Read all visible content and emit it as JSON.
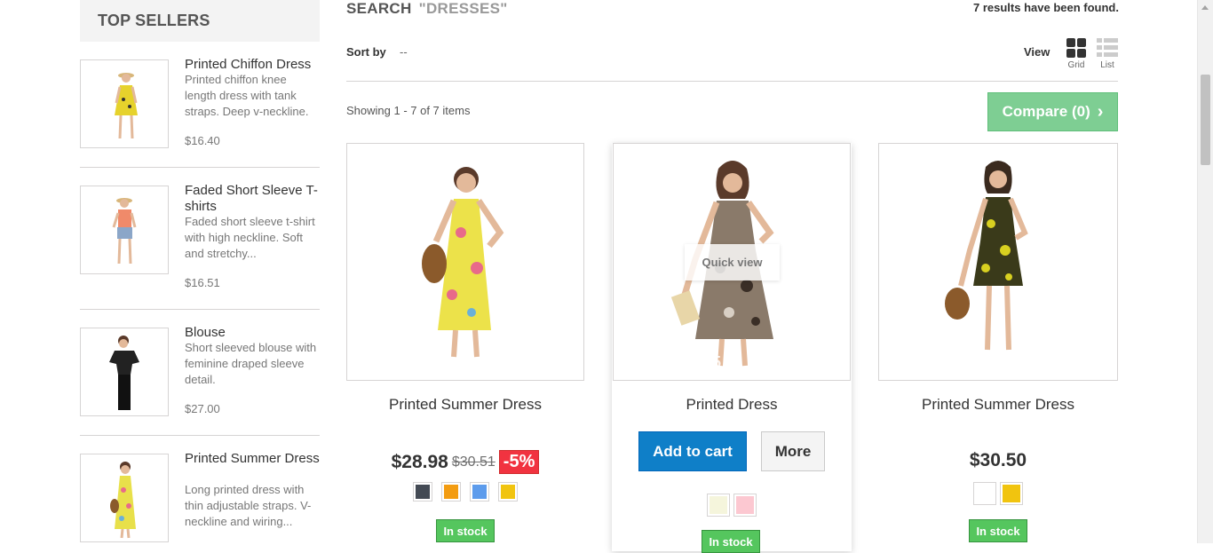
{
  "sidebar": {
    "title": "TOP SELLERS",
    "items": [
      {
        "title": "Printed Chiffon Dress",
        "desc": "Printed chiffon knee length dress with tank straps. Deep v-neckline.",
        "price": "$16.40"
      },
      {
        "title": "Faded Short Sleeve T-shirts",
        "desc": "Faded short sleeve t-shirt with high neckline. Soft and stretchy...",
        "price": "$16.51"
      },
      {
        "title": "Blouse",
        "desc": "Short sleeved blouse with feminine draped sleeve detail.",
        "price": "$27.00"
      },
      {
        "title": "Printed Summer Dress",
        "desc": "Long printed dress with thin adjustable straps. V-neckline and wiring...",
        "price": ""
      }
    ]
  },
  "search": {
    "heading": "SEARCH",
    "query": "\"DRESSES\"",
    "results": "7 results have been found."
  },
  "toolbar": {
    "sort_label": "Sort by",
    "sort_value": "--",
    "view_label": "View",
    "grid_label": "Grid",
    "list_label": "List",
    "showing": "Showing 1 - 7 of 7 items",
    "compare": "Compare (0)"
  },
  "products": [
    {
      "name": "Printed Summer Dress",
      "price": "$28.98",
      "old_price": "$30.51",
      "reduction": "-5%",
      "stock": "In stock",
      "swatches": [
        "#434a54",
        "#f39c11",
        "#5d9cec",
        "#f1c40f"
      ]
    },
    {
      "name": "Printed Dress",
      "ghost_price": "$5",
      "quick_view": "Quick view",
      "add_to_cart": "Add to cart",
      "more": "More",
      "stock": "In stock",
      "swatches": [
        "#f5f5dc",
        "#fcc8d1"
      ]
    },
    {
      "name": "Printed Summer Dress",
      "price": "$30.50",
      "stock": "In stock",
      "swatches": [
        "#ffffff",
        "#f1c40f"
      ]
    }
  ]
}
